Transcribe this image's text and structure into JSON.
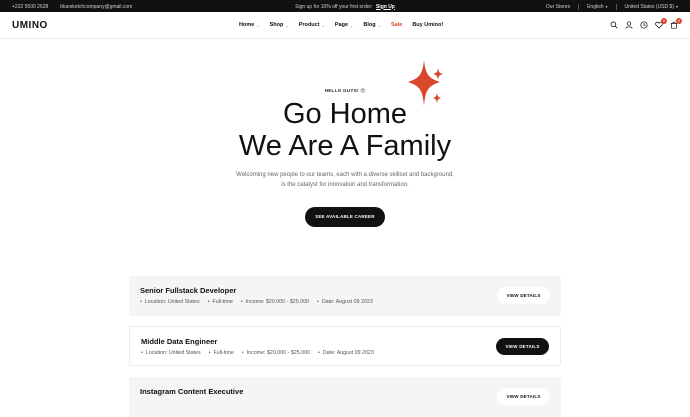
{
  "topbar": {
    "phone": "+222 5500 2628",
    "email": "bluesketchcompany@gmail.com",
    "promo_text": "Sign up for 10% off your first order:",
    "promo_link": "Sign Up",
    "stores": "Our Stores",
    "language": "English",
    "currency": "United States (USD $)"
  },
  "header": {
    "logo": "UMINO",
    "nav": [
      {
        "label": "Home",
        "dropdown": true
      },
      {
        "label": "Shop",
        "dropdown": true
      },
      {
        "label": "Product",
        "dropdown": true
      },
      {
        "label": "Page",
        "dropdown": true
      },
      {
        "label": "Blog",
        "dropdown": true
      },
      {
        "label": "Sale",
        "dropdown": false
      },
      {
        "label": "Buy Umino!",
        "dropdown": false
      }
    ],
    "icons": [
      "search-icon",
      "user-icon",
      "compare-icon",
      "wishlist-icon",
      "cart-icon"
    ],
    "wishlist_count": "0",
    "cart_count": "0",
    "accent_color": "#d9482b"
  },
  "hero": {
    "eyebrow": "HELLO GUYS! 😍",
    "title_line1": "Go Home",
    "title_line2": "We Are A Family",
    "subtitle_line1": "Welcoming new people to our teams, each with a diverse skillset and background,",
    "subtitle_line2": "is the catalyst for innovation and transformation.",
    "cta_label": "SEE AVAILABLE CAREER"
  },
  "jobs": [
    {
      "title": "Senior Fullstack Developer",
      "location": "Location: United States",
      "type": "Full-time",
      "income": "Income: $20.000 - $25.000",
      "date": "Date: August 09 2023",
      "button": "VIEW DETAILS"
    },
    {
      "title": "Middle Data Engineer",
      "location": "Location: United States",
      "type": "Full-time",
      "income": "Income: $20.000 - $25.000",
      "date": "Date: August 09 2023",
      "button": "VIEW DETAILS"
    },
    {
      "title": "Instagram Content Executive",
      "button": "VIEW DETAILS"
    }
  ]
}
